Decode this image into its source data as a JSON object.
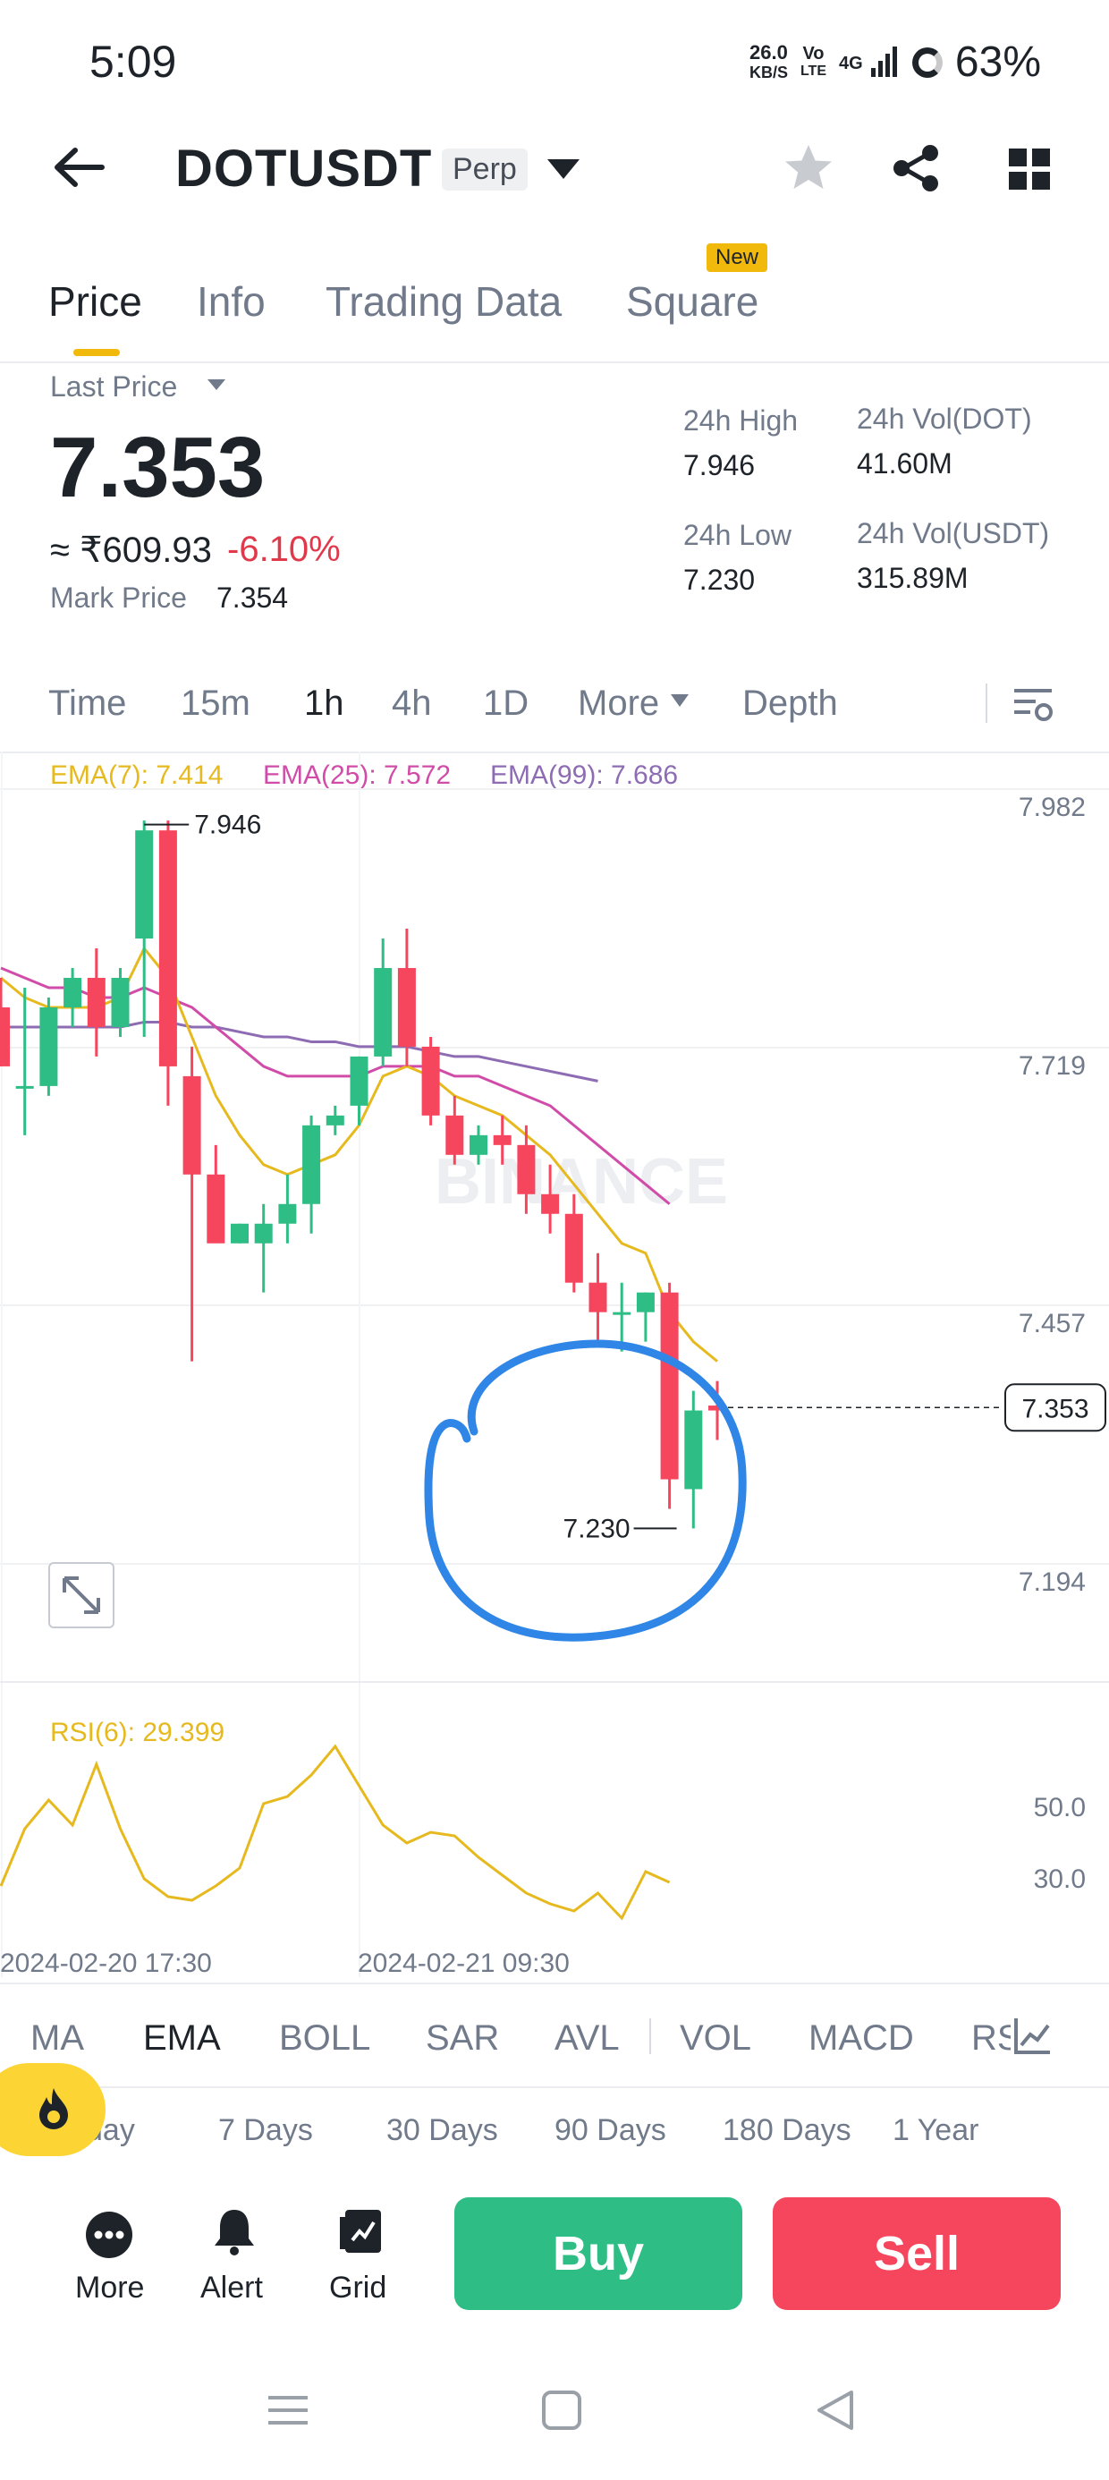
{
  "status_bar": {
    "time": "5:09",
    "net_speed_value": "26.0",
    "net_speed_unit": "KB/S",
    "volte_top": "Vo",
    "volte_bottom": "LTE",
    "signal": "4G",
    "battery": "63%"
  },
  "header": {
    "symbol": "DOTUSDT",
    "badge": "Perp"
  },
  "tabs": [
    {
      "label": "Price",
      "active": true
    },
    {
      "label": "Info"
    },
    {
      "label": "Trading Data"
    },
    {
      "label": "Square"
    }
  ],
  "new_badge": "New",
  "price": {
    "last_price_label": "Last Price",
    "value": "7.353",
    "inr": "≈ ₹609.93",
    "change": "-6.10%",
    "mark_label": "Mark Price",
    "mark_value": "7.354"
  },
  "stats": {
    "high_label": "24h High",
    "high_value": "7.946",
    "low_label": "24h Low",
    "low_value": "7.230",
    "vol_dot_label": "24h Vol(DOT)",
    "vol_dot_value": "41.60M",
    "vol_usdt_label": "24h Vol(USDT)",
    "vol_usdt_value": "315.89M"
  },
  "intervals": [
    "Time",
    "15m",
    "1h",
    "4h",
    "1D",
    "More",
    "Depth"
  ],
  "active_interval": "1h",
  "ema_legend": {
    "ema7": "EMA(7): 7.414",
    "ema25": "EMA(25): 7.572",
    "ema99": "EMA(99): 7.686"
  },
  "watermark": "BINANCE",
  "rsi_label": "RSI(6): 29.399",
  "indicator_tabs": [
    "MA",
    "EMA",
    "BOLL",
    "SAR",
    "AVL",
    "VOL",
    "MACD",
    "RS"
  ],
  "active_indicator": "EMA",
  "periods": [
    "day",
    "7 Days",
    "30 Days",
    "90 Days",
    "180 Days",
    "1 Year"
  ],
  "actions": {
    "more": "More",
    "alert": "Alert",
    "grid": "Grid",
    "buy": "Buy",
    "sell": "Sell"
  },
  "colors": {
    "up": "#2ebd85",
    "down": "#f6465d",
    "ema7": "#e6b91e",
    "ema25": "#d04ca8",
    "ema99": "#8d6cb3",
    "annotation": "#2f86e6",
    "brand": "#f0b90b"
  },
  "chart_data": {
    "type": "candlestick",
    "y_ticks": [
      "7.982",
      "7.719",
      "7.457",
      "7.194"
    ],
    "ylim": [
      7.194,
      7.982
    ],
    "current_price": "7.353",
    "high_marker": "7.946",
    "low_marker": "7.230",
    "x_ticks": [
      "2024-02-20 17:30",
      "2024-02-21 09:30"
    ],
    "candles": [
      {
        "o": 7.76,
        "h": 7.79,
        "l": 7.7,
        "c": 7.7
      },
      {
        "o": 7.68,
        "h": 7.78,
        "l": 7.63,
        "c": 7.68
      },
      {
        "o": 7.68,
        "h": 7.77,
        "l": 7.67,
        "c": 7.76
      },
      {
        "o": 7.76,
        "h": 7.8,
        "l": 7.74,
        "c": 7.79
      },
      {
        "o": 7.79,
        "h": 7.82,
        "l": 7.71,
        "c": 7.74
      },
      {
        "o": 7.74,
        "h": 7.8,
        "l": 7.73,
        "c": 7.79
      },
      {
        "o": 7.83,
        "h": 7.95,
        "l": 7.73,
        "c": 7.94
      },
      {
        "o": 7.94,
        "h": 7.95,
        "l": 7.66,
        "c": 7.7
      },
      {
        "o": 7.69,
        "h": 7.72,
        "l": 7.4,
        "c": 7.59
      },
      {
        "o": 7.59,
        "h": 7.62,
        "l": 7.53,
        "c": 7.52
      },
      {
        "o": 7.52,
        "h": 7.54,
        "l": 7.52,
        "c": 7.54
      },
      {
        "o": 7.52,
        "h": 7.56,
        "l": 7.47,
        "c": 7.54
      },
      {
        "o": 7.54,
        "h": 7.59,
        "l": 7.52,
        "c": 7.56
      },
      {
        "o": 7.56,
        "h": 7.65,
        "l": 7.53,
        "c": 7.64
      },
      {
        "o": 7.64,
        "h": 7.66,
        "l": 7.63,
        "c": 7.65
      },
      {
        "o": 7.66,
        "h": 7.71,
        "l": 7.64,
        "c": 7.71
      },
      {
        "o": 7.71,
        "h": 7.83,
        "l": 7.7,
        "c": 7.8
      },
      {
        "o": 7.8,
        "h": 7.84,
        "l": 7.7,
        "c": 7.72
      },
      {
        "o": 7.72,
        "h": 7.73,
        "l": 7.64,
        "c": 7.65
      },
      {
        "o": 7.65,
        "h": 7.67,
        "l": 7.6,
        "c": 7.61
      },
      {
        "o": 7.61,
        "h": 7.64,
        "l": 7.6,
        "c": 7.63
      },
      {
        "o": 7.63,
        "h": 7.65,
        "l": 7.6,
        "c": 7.62
      },
      {
        "o": 7.62,
        "h": 7.64,
        "l": 7.55,
        "c": 7.57
      },
      {
        "o": 7.57,
        "h": 7.6,
        "l": 7.53,
        "c": 7.55
      },
      {
        "o": 7.55,
        "h": 7.57,
        "l": 7.47,
        "c": 7.48
      },
      {
        "o": 7.48,
        "h": 7.51,
        "l": 7.42,
        "c": 7.45
      },
      {
        "o": 7.45,
        "h": 7.48,
        "l": 7.41,
        "c": 7.45
      },
      {
        "o": 7.45,
        "h": 7.47,
        "l": 7.42,
        "c": 7.47
      },
      {
        "o": 7.47,
        "h": 7.48,
        "l": 7.25,
        "c": 7.28
      },
      {
        "o": 7.27,
        "h": 7.37,
        "l": 7.23,
        "c": 7.35
      },
      {
        "o": 7.355,
        "h": 7.38,
        "l": 7.32,
        "c": 7.35
      }
    ],
    "ema7": [
      7.79,
      7.77,
      7.76,
      7.76,
      7.76,
      7.77,
      7.82,
      7.79,
      7.73,
      7.67,
      7.63,
      7.6,
      7.59,
      7.6,
      7.61,
      7.64,
      7.69,
      7.7,
      7.69,
      7.67,
      7.66,
      7.65,
      7.63,
      7.61,
      7.58,
      7.55,
      7.52,
      7.51,
      7.45,
      7.42,
      7.4
    ],
    "ema25": [
      7.8,
      7.79,
      7.78,
      7.78,
      7.77,
      7.77,
      7.78,
      7.77,
      7.76,
      7.74,
      7.72,
      7.7,
      7.69,
      7.69,
      7.69,
      7.69,
      7.7,
      7.7,
      7.7,
      7.69,
      7.69,
      7.68,
      7.67,
      7.66,
      7.64,
      7.62,
      7.6,
      7.58,
      7.56
    ],
    "ema99": [
      7.74,
      7.74,
      7.74,
      7.74,
      7.74,
      7.74,
      7.745,
      7.745,
      7.74,
      7.74,
      7.735,
      7.73,
      7.73,
      7.725,
      7.725,
      7.72,
      7.72,
      7.72,
      7.715,
      7.71,
      7.71,
      7.705,
      7.7,
      7.695,
      7.69,
      7.685
    ],
    "rsi_ticks": [
      "50.0",
      "30.0"
    ],
    "rsi_values": [
      28,
      44,
      52,
      45,
      62,
      44,
      30,
      25,
      24,
      28,
      33,
      51,
      53,
      59,
      67,
      56,
      45,
      40,
      43,
      42,
      36,
      31,
      26,
      23,
      21,
      26,
      19,
      32,
      29
    ]
  }
}
